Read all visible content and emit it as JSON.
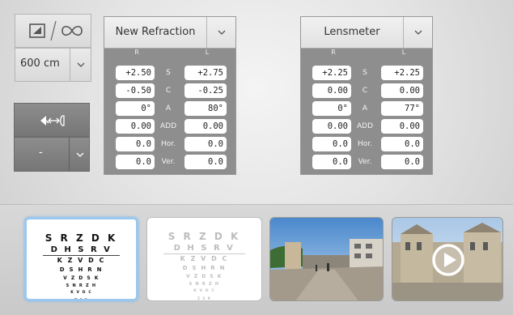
{
  "distance": {
    "toggle_icons": [
      "contrast-square-icon",
      "infinity-icon"
    ],
    "value": "600 cm",
    "dropdown_icon": "chevron-down-icon"
  },
  "occluder": {
    "icon": "eye-distance-icon",
    "value": "-",
    "dropdown_icon": "chevron-down-icon"
  },
  "refraction": {
    "title": "New Refraction",
    "right_header": "R",
    "left_header": "L",
    "rows": [
      {
        "label": "S",
        "right": "+2.50",
        "left": "+2.75"
      },
      {
        "label": "C",
        "right": "-0.50",
        "left": "-0.25"
      },
      {
        "label": "A",
        "right": "0°",
        "left": "80°"
      },
      {
        "label": "ADD",
        "right": "0.00",
        "left": "0.00"
      },
      {
        "label": "Hor.",
        "right": "0.0",
        "left": "0.0"
      },
      {
        "label": "Ver.",
        "right": "0.0",
        "left": "0.0"
      }
    ]
  },
  "lensmeter": {
    "title": "Lensmeter",
    "right_header": "R",
    "left_header": "L",
    "rows": [
      {
        "label": "S",
        "right": "+2.25",
        "left": "+2.25"
      },
      {
        "label": "C",
        "right": "0.00",
        "left": "0.00"
      },
      {
        "label": "A",
        "right": "0°",
        "left": "77°"
      },
      {
        "label": "ADD",
        "right": "0.00",
        "left": "0.00"
      },
      {
        "label": "Hor.",
        "right": "0.0",
        "left": "0.0"
      },
      {
        "label": "Ver.",
        "right": "0.0",
        "left": "0.0"
      }
    ]
  },
  "thumbnails": {
    "items": [
      {
        "name": "chart-clear",
        "selected": true
      },
      {
        "name": "chart-blurred",
        "selected": false
      },
      {
        "name": "street-scene",
        "selected": false
      },
      {
        "name": "street-video",
        "selected": false,
        "icon": "play-icon"
      }
    ],
    "chart_lines": [
      "S R Z D K",
      "D H S R V",
      "K Z V D C",
      "D S H R N",
      "V Z D S K",
      "S N R Z H",
      "K V D C",
      "Z S R"
    ]
  },
  "colors": {
    "selected_border": "#9cc8ef",
    "dark_button": "#808080",
    "panel_gray": "#8e8e8e"
  }
}
